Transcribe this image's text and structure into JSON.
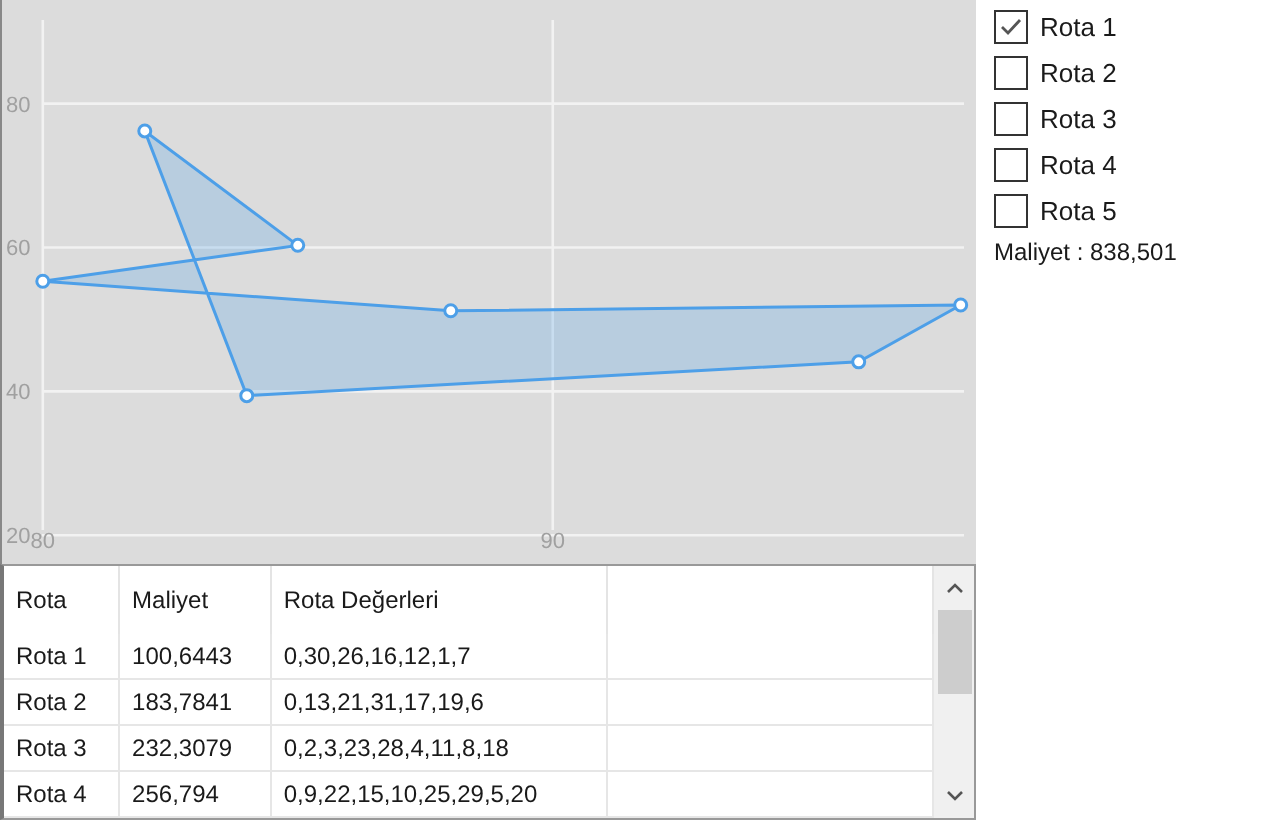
{
  "chart": {
    "chart_data": {
      "type": "area",
      "x": [
        80,
        85,
        82,
        84,
        96,
        98,
        88,
        80
      ],
      "series": [
        {
          "color": "#4d9fe8",
          "values": [
            55.3,
            60.3,
            76.2,
            39.4,
            44.1,
            52,
            51.2,
            55.3
          ]
        }
      ],
      "xlim": [
        79.2,
        98.3
      ],
      "ylim": [
        16,
        94.4
      ],
      "grid": true,
      "xticks": [
        80,
        90
      ],
      "yticks": [
        20,
        40,
        60,
        80
      ]
    }
  },
  "routes": [
    {
      "label": "Rota 1",
      "checked": true
    },
    {
      "label": "Rota 2",
      "checked": false
    },
    {
      "label": "Rota 3",
      "checked": false
    },
    {
      "label": "Rota 4",
      "checked": false
    },
    {
      "label": "Rota 5",
      "checked": false
    }
  ],
  "total_cost": "Maliyet : 838,501",
  "table": {
    "columns": [
      "Rota",
      "Maliyet",
      "Rota Değerleri"
    ],
    "rows": [
      [
        "Rota 1",
        "100,6443",
        "0,30,26,16,12,1,7"
      ],
      [
        "Rota 2",
        "183,7841",
        "0,13,21,31,17,19,6"
      ],
      [
        "Rota 3",
        "232,3079",
        "0,2,3,23,28,4,11,8,18"
      ],
      [
        "Rota 4",
        "256,794",
        "0,9,22,15,10,25,29,5,20"
      ]
    ]
  }
}
